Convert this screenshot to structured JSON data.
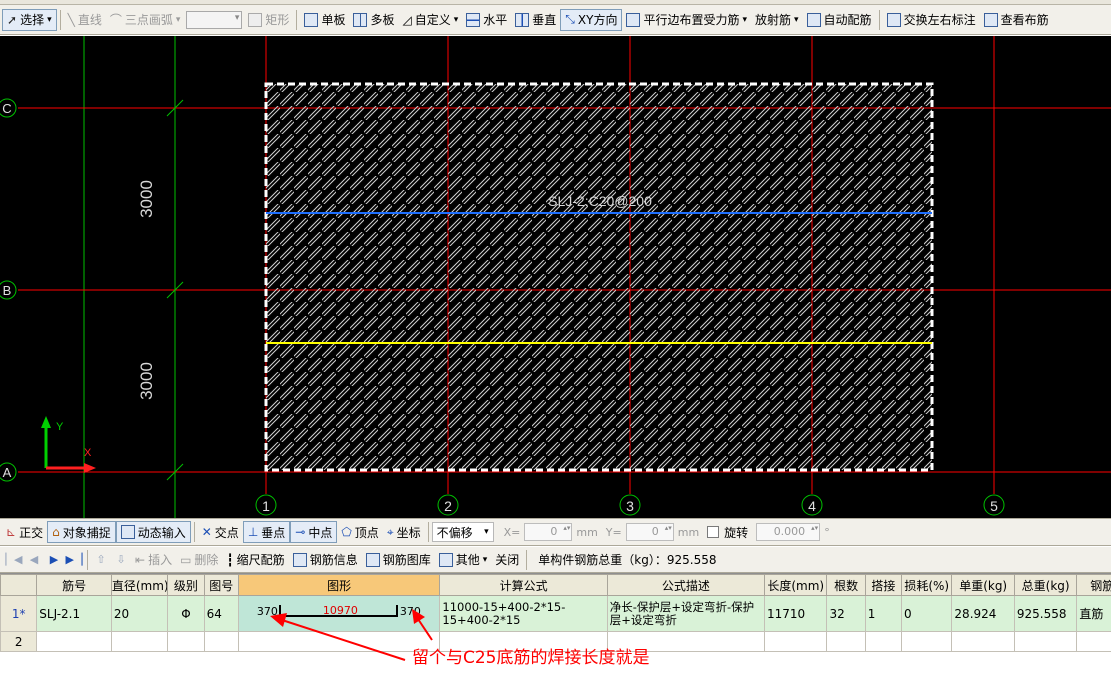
{
  "toolbar": {
    "select_label": "选择",
    "line_label": "直线",
    "arc_label": "三点画弧",
    "rect_label": "矩形",
    "single_board_label": "单板",
    "multi_board_label": "多板",
    "custom_label": "自定义",
    "horizontal_label": "水平",
    "vertical_label": "垂直",
    "xy_direction_label": "XY方向",
    "parallel_edge_label": "平行边布置受力筋",
    "radial_label": "放射筋",
    "auto_rebar_label": "自动配筋",
    "swap_marks_label": "交换左右标注",
    "view_layout_label": "查看布筋"
  },
  "canvas": {
    "background": "#000000",
    "axis_rows": [
      "C",
      "B",
      "A"
    ],
    "axis_cols": [
      "1",
      "2",
      "3",
      "4",
      "5"
    ],
    "dimension_upper": "3000",
    "dimension_lower": "3000",
    "rebar_label": "SLJ-2:C20@200",
    "ucs_y": "Y",
    "ucs_x": "X",
    "colors": {
      "grid_red": "#ff0000",
      "grid_green": "#00c000",
      "rebar_blue": "#1e6fff",
      "rebar_yellow": "#ffff00",
      "dim_text": "#d8d8d8"
    }
  },
  "snapbar": {
    "ortho_label": "正交",
    "osnap_label": "对象捕捉",
    "dyninput_label": "动态输入",
    "intersection_label": "交点",
    "perpendicular_label": "垂点",
    "midpoint_label": "中点",
    "vertex_label": "顶点",
    "coordinate_label": "坐标",
    "offset_value": "不偏移",
    "x_label": "X=",
    "x_value": "0",
    "y_label": "Y=",
    "y_value": "0",
    "unit": "mm",
    "rotate_label": "旋转",
    "rotate_value": "0.000",
    "degree": "°"
  },
  "navbar": {
    "insert_label": "插入",
    "delete_label": "删除",
    "scale_label": "缩尺配筋",
    "rebar_info_label": "钢筋信息",
    "rebar_library_label": "钢筋图库",
    "other_label": "其他",
    "close_label": "关闭",
    "total_weight": "单构件钢筋总重（kg）：925.558"
  },
  "table": {
    "headers": [
      "筋号",
      "直径(mm)",
      "级别",
      "图号",
      "图形",
      "计算公式",
      "公式描述",
      "长度(mm)",
      "根数",
      "搭接",
      "损耗(%)",
      "单重(kg)",
      "总重(kg)",
      "钢筋归"
    ],
    "rows": [
      {
        "rownum": "1*",
        "id": "SLJ-2.1",
        "diameter": "20",
        "grade": "Φ",
        "fig_no": "64",
        "shape_left": "370",
        "shape_mid": "10970",
        "shape_right": "370",
        "formula": "11000-15+400-2*15-15+400-2*15",
        "description": "净长-保护层+设定弯折-保护层+设定弯折",
        "length": "11710",
        "count": "32",
        "lap": "1",
        "loss": "0",
        "unit_weight": "28.924",
        "total_weight": "925.558",
        "category": "直筋"
      },
      {
        "rownum": "2"
      }
    ]
  },
  "annotation": {
    "text": "留个与C25底筋的焊接长度就是",
    "color": "#ff0000"
  }
}
